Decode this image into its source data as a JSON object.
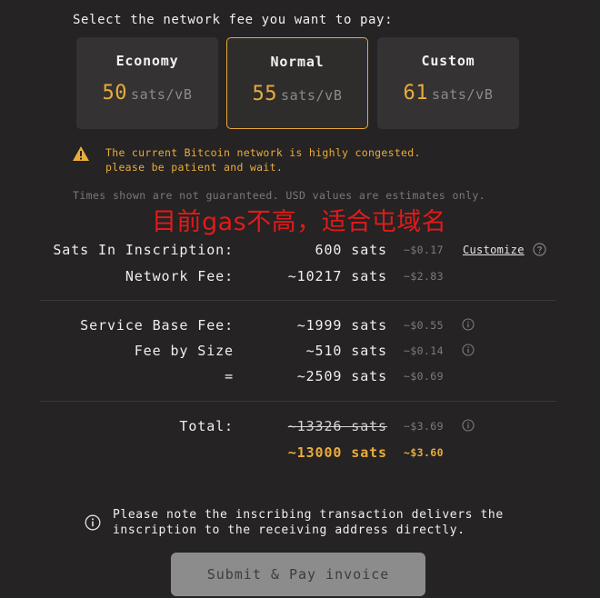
{
  "heading": "Select the network fee you want to pay:",
  "fee_options": [
    {
      "name": "Economy",
      "rate": "50",
      "unit": "sats/vB",
      "selected": false
    },
    {
      "name": "Normal",
      "rate": "55",
      "unit": "sats/vB",
      "selected": true
    },
    {
      "name": "Custom",
      "rate": "61",
      "unit": "sats/vB",
      "selected": false
    }
  ],
  "warning": {
    "line1": "The current Bitcoin network is highly congested.",
    "line2": "please be patient and wait."
  },
  "disclaimer": "Times shown are not guaranteed. USD values are estimates only.",
  "overlay_text": "目前gas不高，适合屯域名",
  "summary": {
    "inscription": {
      "label": "Sats In Inscription:",
      "value": "600 sats",
      "usd": "~$0.17",
      "customize": "Customize"
    },
    "network_fee": {
      "label": "Network Fee:",
      "value": "~10217 sats",
      "usd": "~$2.83"
    },
    "service_base_fee": {
      "label": "Service Base Fee:",
      "value": "~1999 sats",
      "usd": "~$0.55"
    },
    "fee_by_size": {
      "label": "Fee by Size",
      "value": "~510 sats",
      "usd": "~$0.14"
    },
    "subtotal": {
      "label": "=",
      "value": "~2509 sats",
      "usd": "~$0.69"
    },
    "total": {
      "label": "Total:",
      "old_value": "~13326 sats",
      "old_usd": "~$3.69",
      "value": "~13000 sats",
      "usd": "~$3.60"
    }
  },
  "note": {
    "line1": "Please note the inscribing transaction delivers the",
    "line2": "inscription to the receiving address directly."
  },
  "submit_label": "Submit & Pay invoice",
  "colors": {
    "accent": "#e9ac3c",
    "background": "#252323",
    "card": "#343232",
    "overlay": "#e21a1a"
  }
}
